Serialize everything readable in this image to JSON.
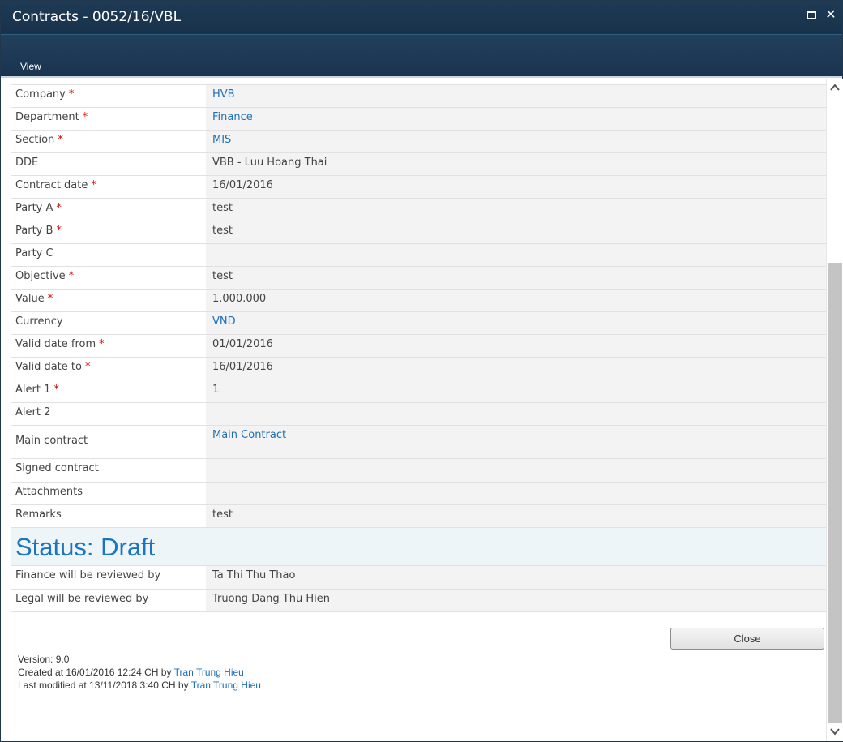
{
  "window": {
    "title": "Contracts - 0052/16/VBL",
    "maximize_icon": "maximize-icon",
    "close_icon": "close-icon"
  },
  "ribbon": {
    "tabs": [
      {
        "label": "View"
      }
    ]
  },
  "form": {
    "required_marker": "*",
    "fields": [
      {
        "label": "Company",
        "value": "HVB"
      },
      {
        "label": "Department",
        "value": "Finance"
      },
      {
        "label": "Section",
        "value": "MIS"
      },
      {
        "label": "DDE",
        "value": "VBB - Luu Hoang Thai"
      },
      {
        "label": "Contract date",
        "value": "16/01/2016"
      },
      {
        "label": "Party A",
        "value": "test"
      },
      {
        "label": "Party B",
        "value": "test"
      },
      {
        "label": "Party C",
        "value": ""
      },
      {
        "label": "Objective",
        "value": "test"
      },
      {
        "label": "Value",
        "value": "1.000.000"
      },
      {
        "label": "Currency",
        "value": "VND"
      },
      {
        "label": "Valid date from",
        "value": "01/01/2016"
      },
      {
        "label": "Valid date to",
        "value": "16/01/2016"
      },
      {
        "label": "Alert 1",
        "value": "1"
      },
      {
        "label": "Alert 2",
        "value": ""
      },
      {
        "label": "Main contract",
        "value": "Main Contract"
      },
      {
        "label": "Signed contract",
        "value": ""
      },
      {
        "label": "Attachments",
        "value": ""
      },
      {
        "label": "Remarks",
        "value": "test"
      }
    ],
    "status": "Status: Draft",
    "reviewers": [
      {
        "label": "Finance will be reviewed by",
        "value": "Ta Thi Thu Thao"
      },
      {
        "label": "Legal will be reviewed by",
        "value": "Truong Dang Thu Hien"
      }
    ]
  },
  "actions": {
    "close_label": "Close"
  },
  "footer": {
    "version": "Version: 9.0",
    "created_prefix": "Created at 16/01/2016 12:24 CH by ",
    "created_by": "Tran Trung Hieu",
    "modified_prefix": "Last modified at 13/11/2018 3:40 CH by ",
    "modified_by": "Tran Trung Hieu"
  },
  "colors": {
    "title_bar": "#1f3a55",
    "link": "#1e6fb8",
    "required": "#dd0000",
    "status": "#1c75bc"
  }
}
